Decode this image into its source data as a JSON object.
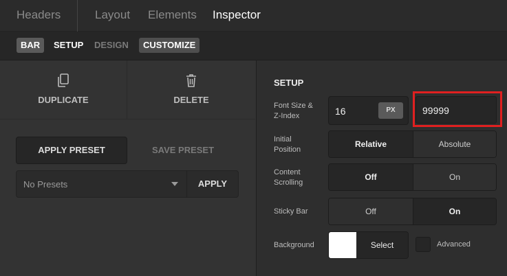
{
  "top_tabs": [
    "Headers",
    "Layout",
    "Elements",
    "Inspector"
  ],
  "sub_tabs": {
    "bar": "BAR",
    "setup": "SETUP",
    "design": "DESIGN",
    "customize": "CUSTOMIZE"
  },
  "left": {
    "duplicate": "DUPLICATE",
    "delete": "DELETE",
    "apply_preset": "APPLY PRESET",
    "save_preset": "SAVE PRESET",
    "presets_value": "No Presets",
    "apply": "APPLY"
  },
  "setup": {
    "heading": "SETUP",
    "font_label_line1": "Font Size &",
    "font_label_line2": "Z-Index",
    "font_size": "16",
    "unit": "PX",
    "z_index": "99999",
    "initial_label_line1": "Initial",
    "initial_label_line2": "Position",
    "initial_options": [
      "Relative",
      "Absolute"
    ],
    "scroll_label_line1": "Content",
    "scroll_label_line2": "Scrolling",
    "scroll_options": [
      "Off",
      "On"
    ],
    "sticky_label": "Sticky Bar",
    "sticky_options": [
      "Off",
      "On"
    ],
    "background_label": "Background",
    "select_label": "Select",
    "advanced_label": "Advanced"
  },
  "colors": {
    "highlight": "#e02020",
    "swatch": "#ffffff"
  }
}
